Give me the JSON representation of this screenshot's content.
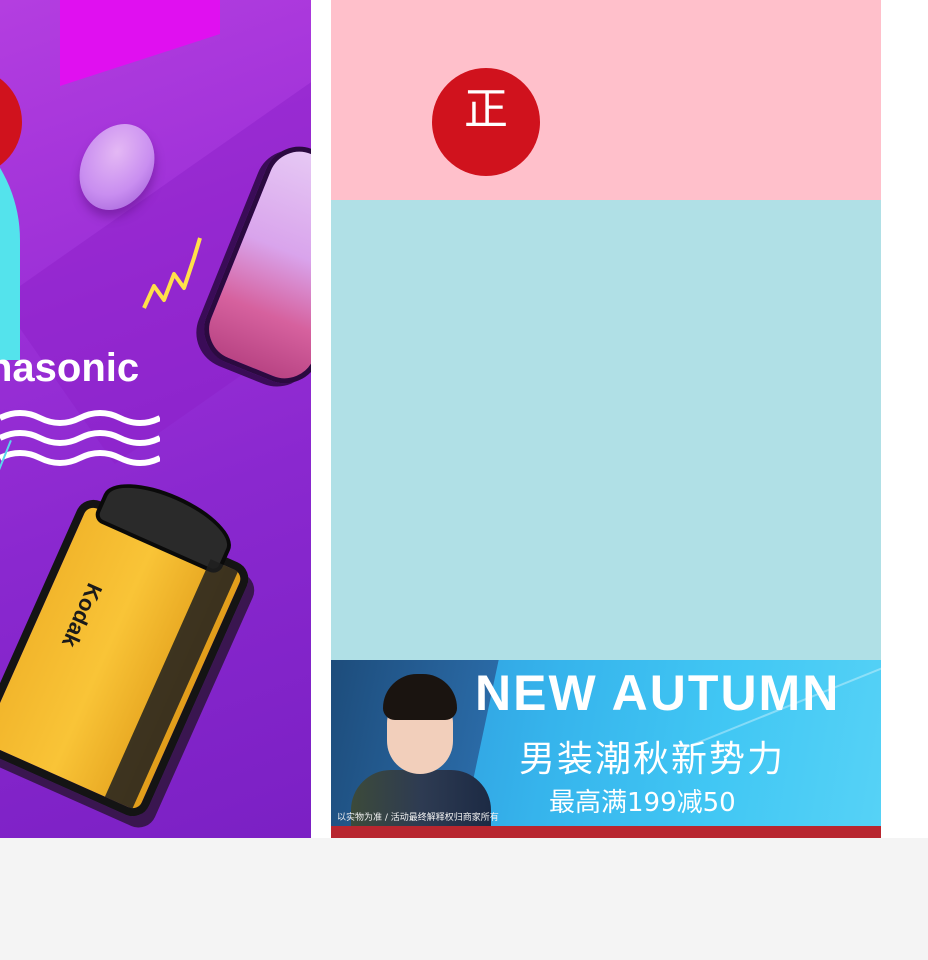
{
  "left_promo": {
    "brand_text": "nasonic",
    "camera_label": "Kodak",
    "colors": {
      "background": "#9a2fd6",
      "accent_cyan": "#54e3ec",
      "accent_magenta": "#e010f0",
      "zigzag": "#ffe04a"
    }
  },
  "placeholders": {
    "top_block_color": "#ffc0cb",
    "middle_block_color": "#b0e0e6"
  },
  "autumn_banner": {
    "headline": "NEW AUTUMN",
    "subtitle": "男装潮秋新势力",
    "promo": "最高满199减50",
    "fine_print": "以实物为准 / 活动最终解释权归商家所有",
    "colors": {
      "background": "#41c7f4",
      "strip": "#b8262f"
    }
  },
  "service_bar": {
    "left_icon": "service-icon",
    "center_icon": "genuine-guarantee-icon",
    "center_glyph": "正",
    "colors": {
      "background": "#f4f4f4",
      "icon": "#d0121d"
    }
  }
}
